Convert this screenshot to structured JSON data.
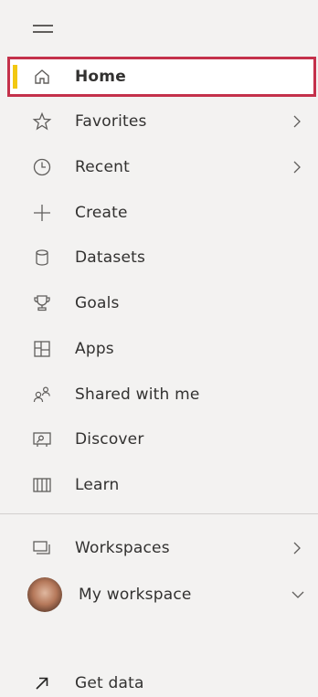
{
  "nav": {
    "menu_icon": "hamburger-icon",
    "items": [
      {
        "id": "home",
        "label": "Home",
        "icon": "home-icon",
        "selected": true
      },
      {
        "id": "favorites",
        "label": "Favorites",
        "icon": "star-icon",
        "chevron": "right"
      },
      {
        "id": "recent",
        "label": "Recent",
        "icon": "clock-icon",
        "chevron": "right"
      },
      {
        "id": "create",
        "label": "Create",
        "icon": "plus-icon"
      },
      {
        "id": "datasets",
        "label": "Datasets",
        "icon": "database-icon"
      },
      {
        "id": "goals",
        "label": "Goals",
        "icon": "trophy-icon"
      },
      {
        "id": "apps",
        "label": "Apps",
        "icon": "apps-icon"
      },
      {
        "id": "shared",
        "label": "Shared with me",
        "icon": "shared-people-icon"
      },
      {
        "id": "discover",
        "label": "Discover",
        "icon": "discover-icon"
      },
      {
        "id": "learn",
        "label": "Learn",
        "icon": "book-icon"
      }
    ],
    "workspaces": {
      "label": "Workspaces",
      "icon": "workspaces-icon",
      "chevron": "right"
    },
    "my_workspace": {
      "label": "My workspace",
      "icon": "avatar",
      "chevron": "down"
    },
    "get_data": {
      "label": "Get data",
      "icon": "arrow-up-right-icon"
    }
  },
  "colors": {
    "background": "#f3f2f1",
    "selected_background": "#ffffff",
    "selected_border": "#c4314b",
    "accent_bar": "#f2c811",
    "text": "#323130",
    "icon": "#605e5c"
  }
}
